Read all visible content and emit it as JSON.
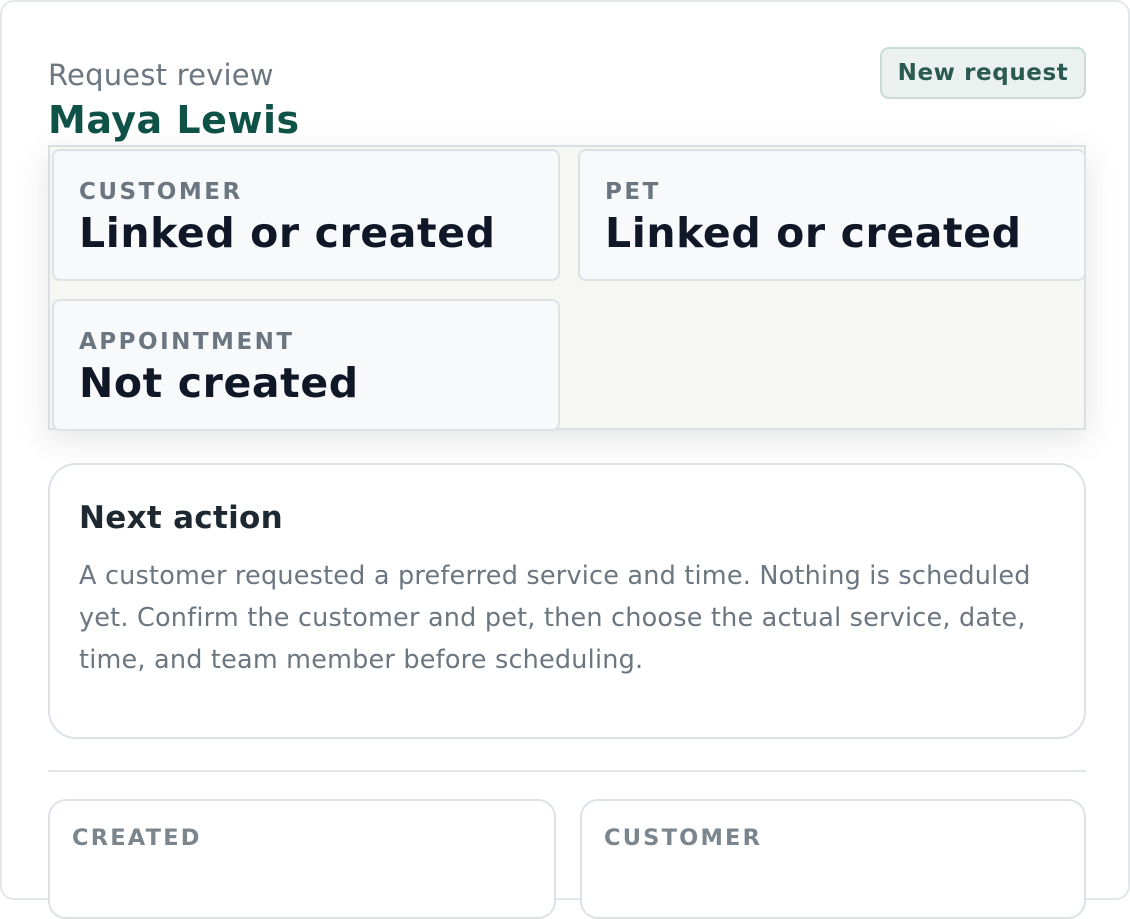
{
  "header": {
    "eyebrow": "Request review",
    "name": "Maya Lewis",
    "badge": "New request"
  },
  "status_cards": [
    {
      "label": "CUSTOMER",
      "value": "Linked or created"
    },
    {
      "label": "PET",
      "value": "Linked or created"
    },
    {
      "label": "APPOINTMENT",
      "value": "Not created"
    }
  ],
  "next_action": {
    "heading": "Next action",
    "body": "A customer requested a preferred service and time. Nothing is scheduled yet. Confirm the customer and pet, then choose the actual service, date, time, and team member before scheduling."
  },
  "details": [
    {
      "label": "CREATED"
    },
    {
      "label": "CUSTOMER"
    }
  ]
}
